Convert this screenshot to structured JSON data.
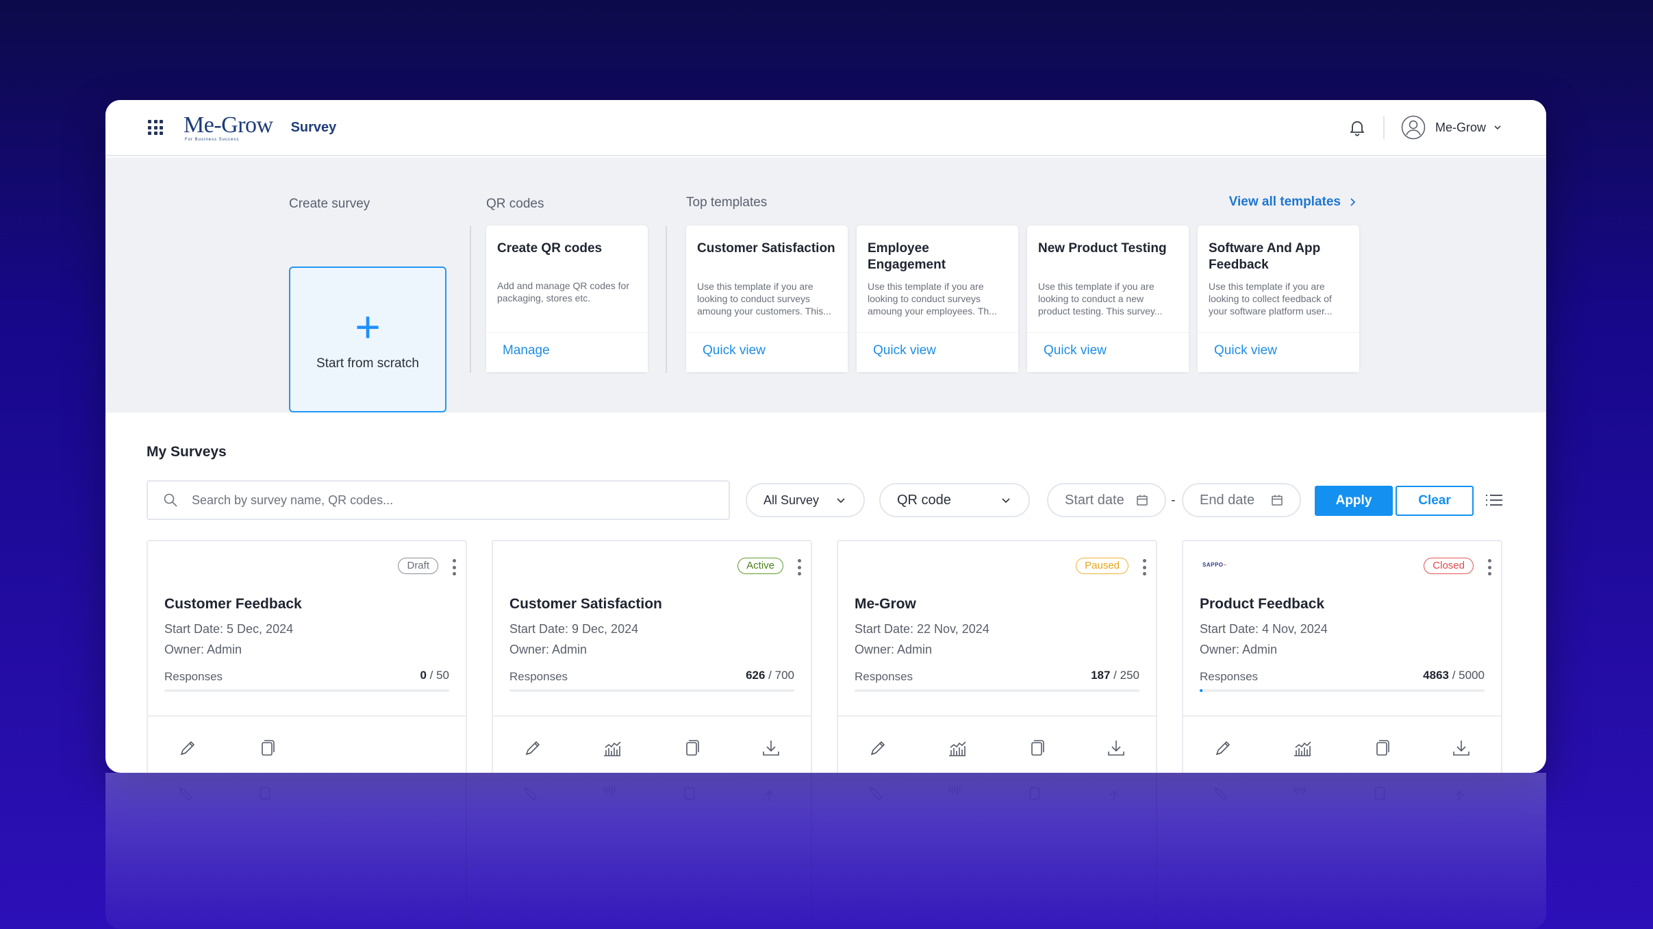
{
  "header": {
    "logo_main": "Me-Grow",
    "logo_sub": "For Business Success",
    "app_name": "Survey",
    "user_name": "Me-Grow"
  },
  "hero": {
    "create_label": "Create survey",
    "create_action": "Start from scratch",
    "qr_label": "QR codes",
    "qr_card": {
      "title": "Create QR codes",
      "desc": "Add and manage QR codes for packaging, stores etc.",
      "link": "Manage"
    },
    "templates_label": "Top templates",
    "view_all": "View all templates",
    "templates": [
      {
        "title": "Customer Satisfaction",
        "desc": "Use this template if you are looking to conduct surveys amoung your customers. This...",
        "link": "Quick view"
      },
      {
        "title": "Employee Engagement",
        "desc": "Use this template if you are looking to conduct surveys amoung your employees. Th...",
        "link": "Quick view"
      },
      {
        "title": "New Product Testing",
        "desc": "Use this template if you are looking to conduct a new product testing. This survey...",
        "link": "Quick view"
      },
      {
        "title": "Software And App Feedback",
        "desc": "Use this template if you are looking to collect feedback of your software platform user...",
        "link": "Quick view"
      }
    ]
  },
  "surveys": {
    "section_title": "My Surveys",
    "search_placeholder": "Search by survey name, QR codes...",
    "filter_survey": "All Survey",
    "filter_qr": "QR code",
    "start_date": "Start date",
    "date_sep": "-",
    "end_date": "End date",
    "apply": "Apply",
    "clear": "Clear",
    "responses_label": "Responses",
    "cards": [
      {
        "status": "Draft",
        "title": "Customer Feedback",
        "start": "Start Date: 5 Dec, 2024",
        "owner": "Owner: Admin",
        "resp_count": "0",
        "resp_total": " / 50",
        "progress": 0
      },
      {
        "status": "Active",
        "title": "Customer Satisfaction",
        "start": "Start Date: 9 Dec, 2024",
        "owner": "Owner: Admin",
        "resp_count": "626",
        "resp_total": " / 700",
        "progress": 0
      },
      {
        "status": "Paused",
        "title": "Me-Grow",
        "start": "Start Date: 22 Nov, 2024",
        "owner": "Owner: Admin",
        "resp_count": "187",
        "resp_total": " / 250",
        "progress": 0
      },
      {
        "status": "Closed",
        "title": "Product Feedback",
        "start": "Start Date: 4 Nov, 2024",
        "owner": "Owner: Admin",
        "resp_count": "4863",
        "resp_total": " / 5000",
        "progress": 0.01,
        "logo_text": "SAPPO"
      }
    ]
  },
  "colors": {
    "accent": "#1490f0",
    "brand": "#1e3c78",
    "draft": "#6a6f7a",
    "active": "#5f9b28",
    "paused": "#f0b233",
    "closed": "#e25555"
  },
  "icons": [
    "apps-grid-icon",
    "bell-icon",
    "user-avatar-icon",
    "chevron-down-icon",
    "plus-icon",
    "chevron-right-icon",
    "search-icon",
    "calendar-icon",
    "list-view-icon",
    "kebab-menu-icon",
    "edit-pencil-icon",
    "analytics-chart-icon",
    "copy-icon",
    "download-icon"
  ]
}
